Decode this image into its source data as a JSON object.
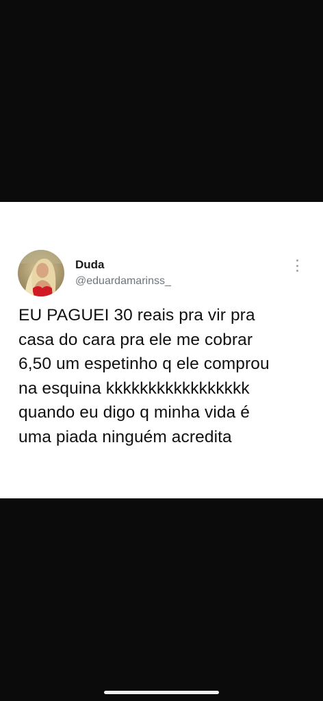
{
  "tweet": {
    "display_name": "Duda",
    "handle": "@eduardamarinss_",
    "text": "EU PAGUEI 30 reais pra vir pra\ncasa do cara pra ele me cobrar\n6,50 um espetinho q ele comprou\nna esquina kkkkkkkkkkkkkkkkk\nquando eu digo q minha vida é\numa piada ninguém acredita"
  },
  "icons": {
    "more": "more-vertical-icon",
    "avatar": "profile-photo"
  },
  "colors": {
    "background": "#0b0b0b",
    "card": "#ffffff",
    "handle": "#6e767d",
    "text": "#111111"
  }
}
